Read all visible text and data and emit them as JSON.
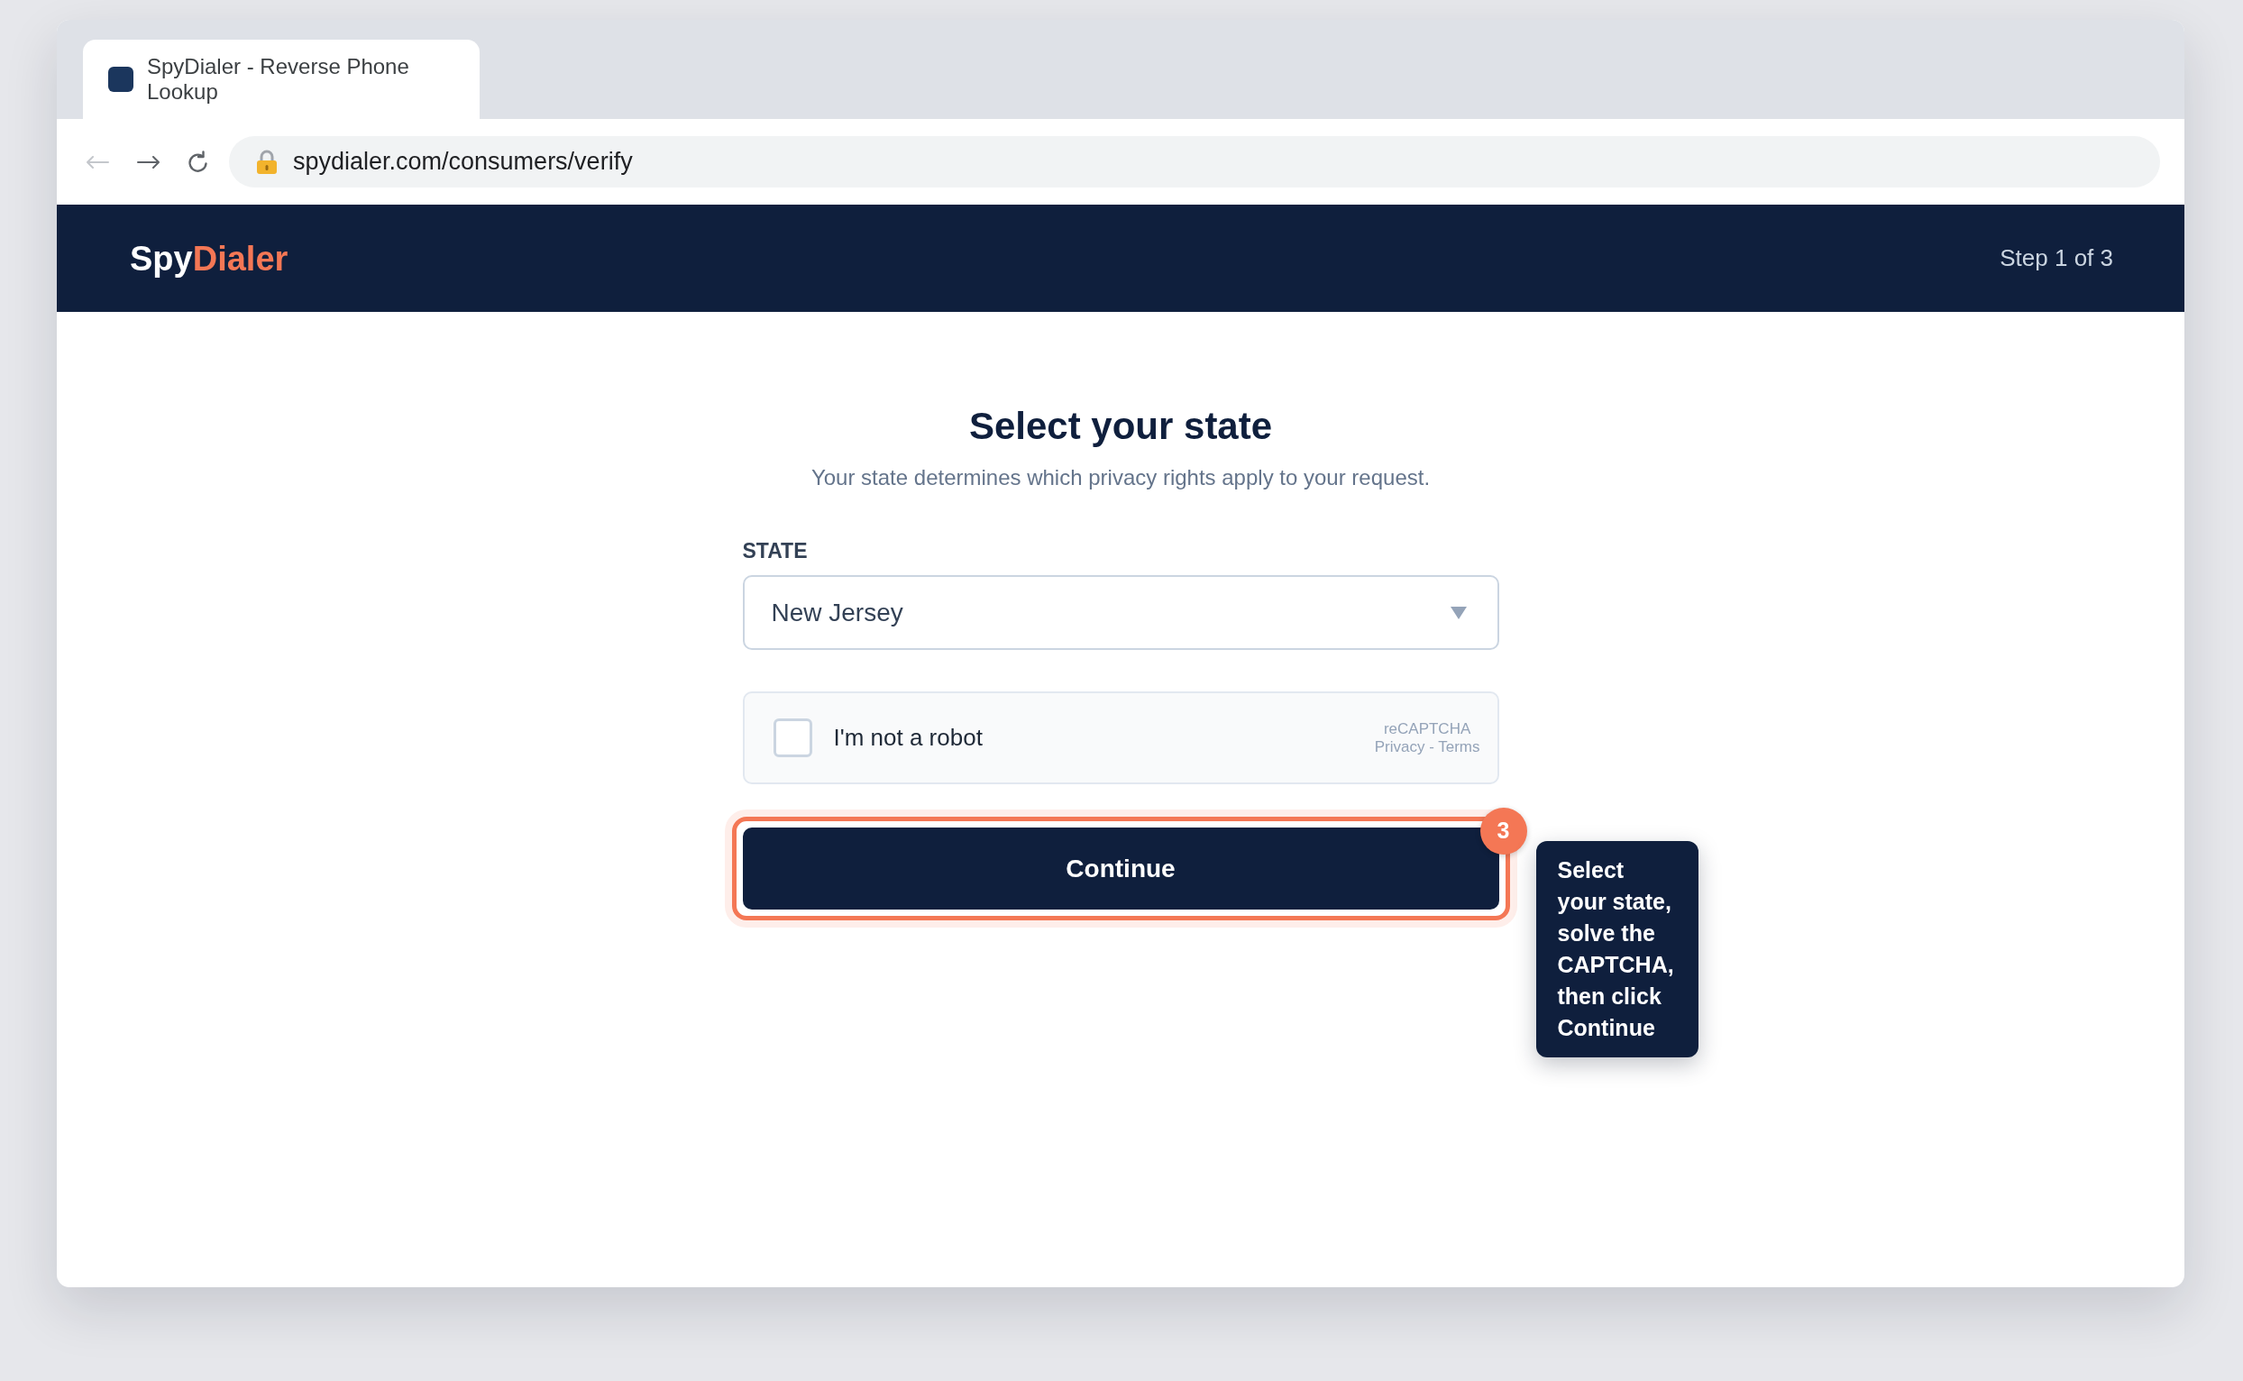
{
  "browser": {
    "tab": {
      "title": "SpyDialer - Reverse Phone Lookup",
      "selected": true
    },
    "nav": {
      "back_disabled": true
    },
    "url": "spydialer.com/consumers/verify"
  },
  "header": {
    "logo": {
      "first": "Spy",
      "second": "Dialer"
    },
    "step": "Step 1 of 3"
  },
  "form": {
    "title": "Select your state",
    "subtitle": "Your state determines which privacy rights apply to your request.",
    "state_field": {
      "label": "STATE",
      "value": "New Jersey"
    },
    "captcha": {
      "label": "I'm not a robot",
      "checked": false,
      "brand": "reCAPTCHA",
      "links": "Privacy - Terms"
    },
    "continue_button": {
      "label": "Continue",
      "highlighted": true
    }
  },
  "guide": {
    "step_badge": "3",
    "tooltip": "Select your state, solve the CAPTCHA, then click Continue"
  }
}
